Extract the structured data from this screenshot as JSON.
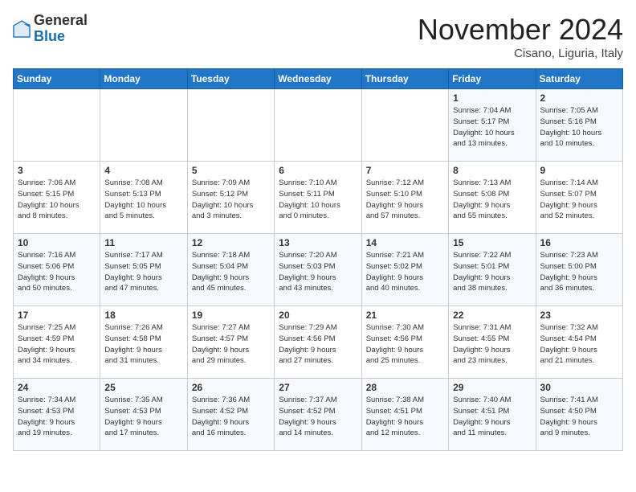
{
  "header": {
    "logo_general": "General",
    "logo_blue": "Blue",
    "month_title": "November 2024",
    "location": "Cisano, Liguria, Italy"
  },
  "weekdays": [
    "Sunday",
    "Monday",
    "Tuesday",
    "Wednesday",
    "Thursday",
    "Friday",
    "Saturday"
  ],
  "weeks": [
    [
      {
        "day": "",
        "info": ""
      },
      {
        "day": "",
        "info": ""
      },
      {
        "day": "",
        "info": ""
      },
      {
        "day": "",
        "info": ""
      },
      {
        "day": "",
        "info": ""
      },
      {
        "day": "1",
        "info": "Sunrise: 7:04 AM\nSunset: 5:17 PM\nDaylight: 10 hours\nand 13 minutes."
      },
      {
        "day": "2",
        "info": "Sunrise: 7:05 AM\nSunset: 5:16 PM\nDaylight: 10 hours\nand 10 minutes."
      }
    ],
    [
      {
        "day": "3",
        "info": "Sunrise: 7:06 AM\nSunset: 5:15 PM\nDaylight: 10 hours\nand 8 minutes."
      },
      {
        "day": "4",
        "info": "Sunrise: 7:08 AM\nSunset: 5:13 PM\nDaylight: 10 hours\nand 5 minutes."
      },
      {
        "day": "5",
        "info": "Sunrise: 7:09 AM\nSunset: 5:12 PM\nDaylight: 10 hours\nand 3 minutes."
      },
      {
        "day": "6",
        "info": "Sunrise: 7:10 AM\nSunset: 5:11 PM\nDaylight: 10 hours\nand 0 minutes."
      },
      {
        "day": "7",
        "info": "Sunrise: 7:12 AM\nSunset: 5:10 PM\nDaylight: 9 hours\nand 57 minutes."
      },
      {
        "day": "8",
        "info": "Sunrise: 7:13 AM\nSunset: 5:08 PM\nDaylight: 9 hours\nand 55 minutes."
      },
      {
        "day": "9",
        "info": "Sunrise: 7:14 AM\nSunset: 5:07 PM\nDaylight: 9 hours\nand 52 minutes."
      }
    ],
    [
      {
        "day": "10",
        "info": "Sunrise: 7:16 AM\nSunset: 5:06 PM\nDaylight: 9 hours\nand 50 minutes."
      },
      {
        "day": "11",
        "info": "Sunrise: 7:17 AM\nSunset: 5:05 PM\nDaylight: 9 hours\nand 47 minutes."
      },
      {
        "day": "12",
        "info": "Sunrise: 7:18 AM\nSunset: 5:04 PM\nDaylight: 9 hours\nand 45 minutes."
      },
      {
        "day": "13",
        "info": "Sunrise: 7:20 AM\nSunset: 5:03 PM\nDaylight: 9 hours\nand 43 minutes."
      },
      {
        "day": "14",
        "info": "Sunrise: 7:21 AM\nSunset: 5:02 PM\nDaylight: 9 hours\nand 40 minutes."
      },
      {
        "day": "15",
        "info": "Sunrise: 7:22 AM\nSunset: 5:01 PM\nDaylight: 9 hours\nand 38 minutes."
      },
      {
        "day": "16",
        "info": "Sunrise: 7:23 AM\nSunset: 5:00 PM\nDaylight: 9 hours\nand 36 minutes."
      }
    ],
    [
      {
        "day": "17",
        "info": "Sunrise: 7:25 AM\nSunset: 4:59 PM\nDaylight: 9 hours\nand 34 minutes."
      },
      {
        "day": "18",
        "info": "Sunrise: 7:26 AM\nSunset: 4:58 PM\nDaylight: 9 hours\nand 31 minutes."
      },
      {
        "day": "19",
        "info": "Sunrise: 7:27 AM\nSunset: 4:57 PM\nDaylight: 9 hours\nand 29 minutes."
      },
      {
        "day": "20",
        "info": "Sunrise: 7:29 AM\nSunset: 4:56 PM\nDaylight: 9 hours\nand 27 minutes."
      },
      {
        "day": "21",
        "info": "Sunrise: 7:30 AM\nSunset: 4:56 PM\nDaylight: 9 hours\nand 25 minutes."
      },
      {
        "day": "22",
        "info": "Sunrise: 7:31 AM\nSunset: 4:55 PM\nDaylight: 9 hours\nand 23 minutes."
      },
      {
        "day": "23",
        "info": "Sunrise: 7:32 AM\nSunset: 4:54 PM\nDaylight: 9 hours\nand 21 minutes."
      }
    ],
    [
      {
        "day": "24",
        "info": "Sunrise: 7:34 AM\nSunset: 4:53 PM\nDaylight: 9 hours\nand 19 minutes."
      },
      {
        "day": "25",
        "info": "Sunrise: 7:35 AM\nSunset: 4:53 PM\nDaylight: 9 hours\nand 17 minutes."
      },
      {
        "day": "26",
        "info": "Sunrise: 7:36 AM\nSunset: 4:52 PM\nDaylight: 9 hours\nand 16 minutes."
      },
      {
        "day": "27",
        "info": "Sunrise: 7:37 AM\nSunset: 4:52 PM\nDaylight: 9 hours\nand 14 minutes."
      },
      {
        "day": "28",
        "info": "Sunrise: 7:38 AM\nSunset: 4:51 PM\nDaylight: 9 hours\nand 12 minutes."
      },
      {
        "day": "29",
        "info": "Sunrise: 7:40 AM\nSunset: 4:51 PM\nDaylight: 9 hours\nand 11 minutes."
      },
      {
        "day": "30",
        "info": "Sunrise: 7:41 AM\nSunset: 4:50 PM\nDaylight: 9 hours\nand 9 minutes."
      }
    ]
  ]
}
